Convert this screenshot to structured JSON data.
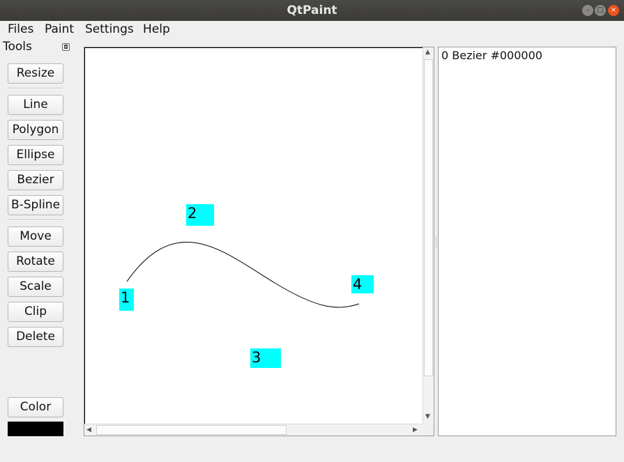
{
  "window": {
    "title": "QtPaint",
    "minimize_glyph": "–",
    "maximize_glyph": "□",
    "close_glyph": "×"
  },
  "menu": {
    "files": "Files",
    "paint": "Paint",
    "settings": "Settings",
    "help": "Help"
  },
  "tools": {
    "title": "Tools",
    "float_icon": "float-window-icon",
    "buttons": {
      "resize": "Resize",
      "line": "Line",
      "polygon": "Polygon",
      "ellipse": "Ellipse",
      "bezier": "Bezier",
      "bspline": "B-Spline",
      "move": "Move",
      "rotate": "Rotate",
      "scale": "Scale",
      "clip": "Clip",
      "delete": "Delete",
      "color": "Color"
    },
    "current_color": "#000000"
  },
  "canvas": {
    "control_points": [
      "1",
      "2",
      "3",
      "4"
    ],
    "control_point_color": "#00ffff",
    "curve_color": "#000000"
  },
  "shapes_list": {
    "items": [
      "0 Bezier #000000"
    ]
  }
}
